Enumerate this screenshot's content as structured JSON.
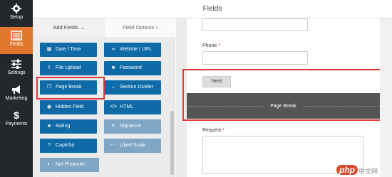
{
  "header": {
    "title": "Fields"
  },
  "sidebar": {
    "items": [
      {
        "label": "Setup",
        "icon": "gear-icon",
        "active": false
      },
      {
        "label": "Fields",
        "icon": "list-icon",
        "active": true
      },
      {
        "label": "Settings",
        "icon": "sliders-icon",
        "active": false
      },
      {
        "label": "Marketing",
        "icon": "megaphone-icon",
        "active": false
      },
      {
        "label": "Payments",
        "icon": "dollar-icon",
        "active": false
      }
    ]
  },
  "tabs": {
    "add_fields": "Add Fields",
    "field_options": "Field Options"
  },
  "fields": [
    {
      "label": "Date / Time",
      "icon": "calendar-icon",
      "disabled": false
    },
    {
      "label": "Website / URL",
      "icon": "link-icon",
      "disabled": false
    },
    {
      "label": "File Upload",
      "icon": "upload-icon",
      "disabled": false
    },
    {
      "label": "Password",
      "icon": "lock-icon",
      "disabled": false
    },
    {
      "label": "Page Break",
      "icon": "copy-icon",
      "disabled": false
    },
    {
      "label": "Section Divider",
      "icon": "arrows-icon",
      "disabled": false
    },
    {
      "label": "Hidden Field",
      "icon": "eye-slash-icon",
      "disabled": false
    },
    {
      "label": "HTML",
      "icon": "code-icon",
      "disabled": false
    },
    {
      "label": "Rating",
      "icon": "star-icon",
      "disabled": false
    },
    {
      "label": "Signature",
      "icon": "pen-icon",
      "disabled": true
    },
    {
      "label": "Captcha",
      "icon": "question-icon",
      "disabled": false
    },
    {
      "label": "Likert Scale",
      "icon": "dots-icon",
      "disabled": true
    },
    {
      "label": "Net Promoter Score",
      "icon": "gauge-icon",
      "disabled": true
    }
  ],
  "preview": {
    "phone_label": "Phone",
    "required_mark": "*",
    "next_button": "Next",
    "page_break_label": "Page Break",
    "request_label": "Request"
  },
  "watermark": {
    "logo_text": "php",
    "suffix": "中文网"
  },
  "colors": {
    "nav_bg": "#23282d",
    "nav_active": "#e27730",
    "field_button": "#0e6ba8",
    "highlight": "#e0373a"
  }
}
